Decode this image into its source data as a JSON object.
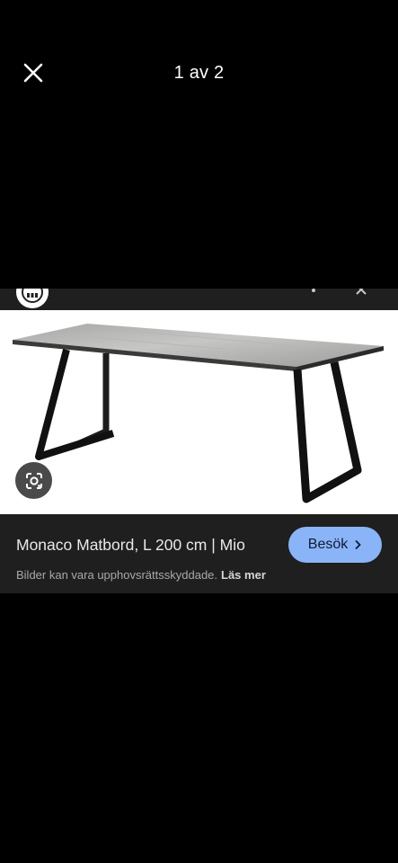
{
  "header": {
    "close_icon": "close-icon",
    "counter": "1 av 2"
  },
  "result": {
    "title": "Monaco Matbord, L 200 cm | Mio",
    "visit_label": "Besök",
    "copyright_text": "Bilder kan vara upphovsrättsskyddade.",
    "read_more": "Läs mer"
  },
  "icons": {
    "lens": "google-lens-icon",
    "chevron": "chevron-right-icon"
  },
  "colors": {
    "background": "#000000",
    "panel": "#1f1f1f",
    "accent": "#8ab4f8"
  }
}
